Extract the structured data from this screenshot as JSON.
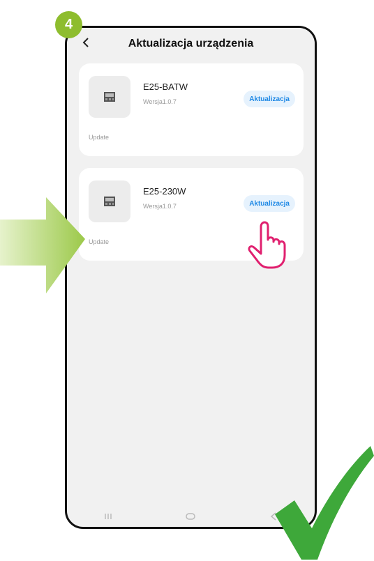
{
  "step_badge": "4",
  "header": {
    "title": "Aktualizacja urządzenia"
  },
  "devices": [
    {
      "name": "E25-BATW",
      "version": "Wersja1.0.7",
      "button_label": "Aktualizacja",
      "note": "Update"
    },
    {
      "name": "E25-230W",
      "version": "Wersja1.0.7",
      "button_label": "Aktualizacja",
      "note": "Update"
    }
  ],
  "icons": {
    "back": "back-chevron-icon",
    "nav": [
      "recent-apps-icon",
      "home-icon",
      "back-icon"
    ],
    "pointer": "hand-pointer-icon",
    "arrow": "green-arrow-icon",
    "check": "checkmark-icon"
  },
  "colors": {
    "accent": "#1e88e5",
    "button_bg": "#e6f2fd",
    "badge": "#8ebd2e",
    "check": "#3ea83a",
    "pointer": "#e0206f"
  }
}
